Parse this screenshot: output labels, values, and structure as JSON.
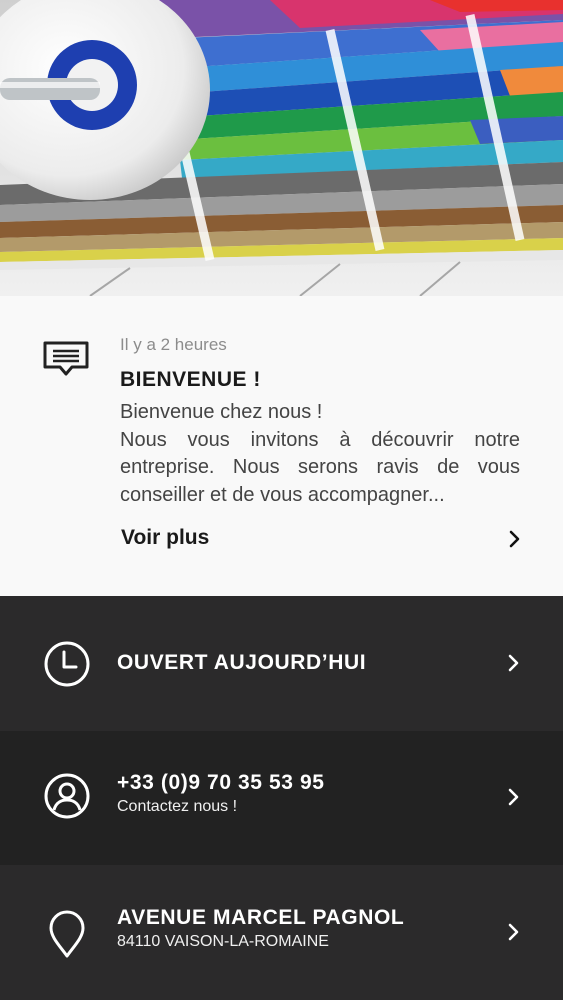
{
  "news": {
    "time": "Il y a 2 heures",
    "title": "BIENVENUE !",
    "body_line1": "Bienvenue chez nous !",
    "body_line2": "Nous vous invitons à découvrir notre entreprise. Nous serons ravis de vous conseiller et de vous accompagner...",
    "more_label": "Voir plus",
    "icon": "message-icon"
  },
  "hours": {
    "label": "OUVERT AUJOURD’HUI",
    "icon": "clock-icon"
  },
  "phone": {
    "number": "+33 (0)9 70 35 53 95",
    "caption": "Contactez nous !",
    "icon": "user-circle-icon"
  },
  "address": {
    "street": "AVENUE MARCEL PAGNOL",
    "city": "84110 VAISON-LA-ROMAINE",
    "icon": "map-pin-icon"
  },
  "colors": {
    "light_bg": "#f9f9f9",
    "dark_row1": "#2b2a2b",
    "dark_row2": "#222222",
    "dark_row3": "#2b2a2b"
  }
}
